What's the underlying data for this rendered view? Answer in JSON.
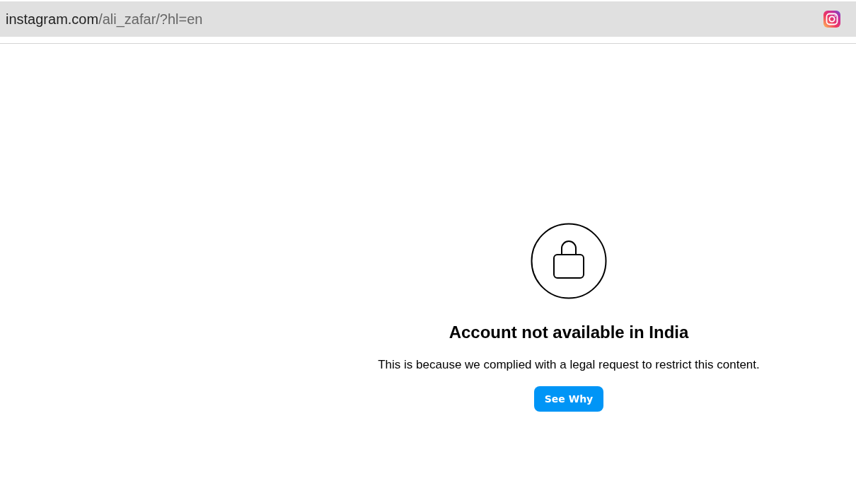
{
  "address_bar": {
    "host": "instagram.com",
    "path": "/ali_zafar/?hl=en"
  },
  "message": {
    "title": "Account not available in India",
    "body": "This is because we complied with a legal request to restrict this content."
  },
  "button": {
    "label": "See Why"
  }
}
